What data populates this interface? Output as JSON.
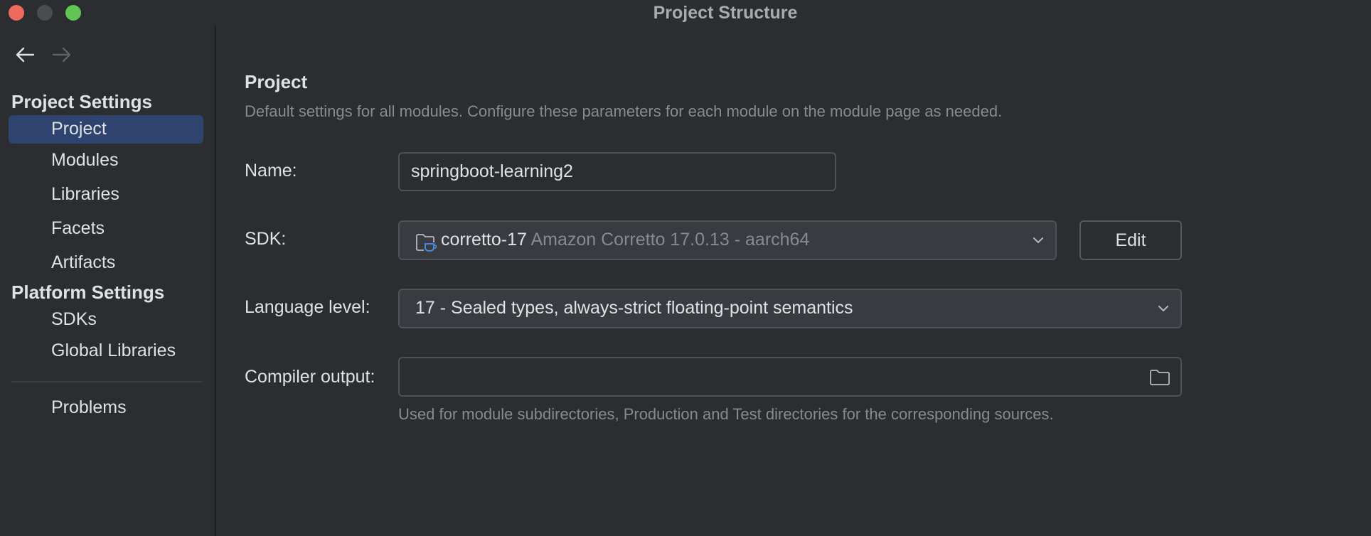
{
  "window": {
    "title": "Project Structure"
  },
  "sidebar": {
    "project_settings_title": "Project Settings",
    "project_items": [
      {
        "label": "Project",
        "selected": true
      },
      {
        "label": "Modules"
      },
      {
        "label": "Libraries"
      },
      {
        "label": "Facets"
      },
      {
        "label": "Artifacts"
      }
    ],
    "platform_settings_title": "Platform Settings",
    "platform_items": [
      {
        "label": "SDKs"
      },
      {
        "label": "Global Libraries"
      }
    ],
    "problems_label": "Problems"
  },
  "main": {
    "heading": "Project",
    "description": "Default settings for all modules. Configure these parameters for each module on the module page as needed.",
    "name": {
      "label": "Name:",
      "value": "springboot-learning2"
    },
    "sdk": {
      "label": "SDK:",
      "name": "corretto-17",
      "detail": "Amazon Corretto 17.0.13 - aarch64",
      "edit_label": "Edit"
    },
    "language_level": {
      "label": "Language level:",
      "value": "17 - Sealed types, always-strict floating-point semantics"
    },
    "compiler_output": {
      "label": "Compiler output:",
      "value": "",
      "hint": "Used for module subdirectories, Production and Test directories for the corresponding sources."
    }
  },
  "colors": {
    "accent_selection": "#2e436e",
    "background": "#2b2d30"
  }
}
